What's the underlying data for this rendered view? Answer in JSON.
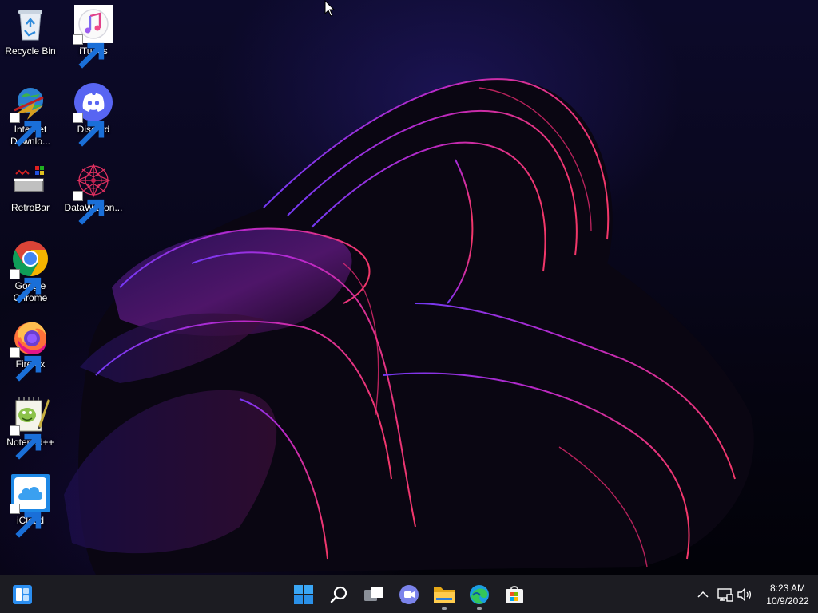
{
  "desktop_icons": [
    {
      "label": "Recycle Bin",
      "icon": "recycle-bin-icon",
      "shortcut": false
    },
    {
      "label": "iTunes",
      "icon": "itunes-icon",
      "shortcut": true
    },
    {
      "label": "Internet Downlo...",
      "icon": "internet-download-manager-icon",
      "shortcut": true
    },
    {
      "label": "Discord",
      "icon": "discord-icon",
      "shortcut": true
    },
    {
      "label": "RetroBar",
      "icon": "retrobar-icon",
      "shortcut": false
    },
    {
      "label": "DataWagon...",
      "icon": "datawagon-icon",
      "shortcut": true
    },
    {
      "label": "Google Chrome",
      "icon": "google-chrome-icon",
      "shortcut": true
    },
    {
      "label": "Firefox",
      "icon": "firefox-icon",
      "shortcut": true
    },
    {
      "label": "Notepad++",
      "icon": "notepad-plus-plus-icon",
      "shortcut": true
    },
    {
      "label": "iCloud",
      "icon": "icloud-icon",
      "shortcut": true
    }
  ],
  "taskbar": {
    "widgets_icon": "widgets-icon",
    "apps": [
      {
        "name": "Start",
        "icon": "windows-start-icon",
        "running": false
      },
      {
        "name": "Search",
        "icon": "search-icon",
        "running": false
      },
      {
        "name": "Task View",
        "icon": "task-view-icon",
        "running": false
      },
      {
        "name": "Chat",
        "icon": "teams-chat-icon",
        "running": false
      },
      {
        "name": "File Explorer",
        "icon": "file-explorer-icon",
        "running": true
      },
      {
        "name": "Microsoft Edge",
        "icon": "edge-icon",
        "running": true
      },
      {
        "name": "Microsoft Store",
        "icon": "store-icon",
        "running": false
      }
    ],
    "tray": {
      "overflow_icon": "chevron-up-icon",
      "network_icon": "network-icon",
      "volume_icon": "volume-icon",
      "time": "8:23 AM",
      "date": "10/9/2022"
    }
  },
  "colors": {
    "taskbar_bg": "#1c1c22",
    "wallpaper_accent_pink": "#e0257a",
    "wallpaper_accent_purple": "#7a3cff"
  }
}
